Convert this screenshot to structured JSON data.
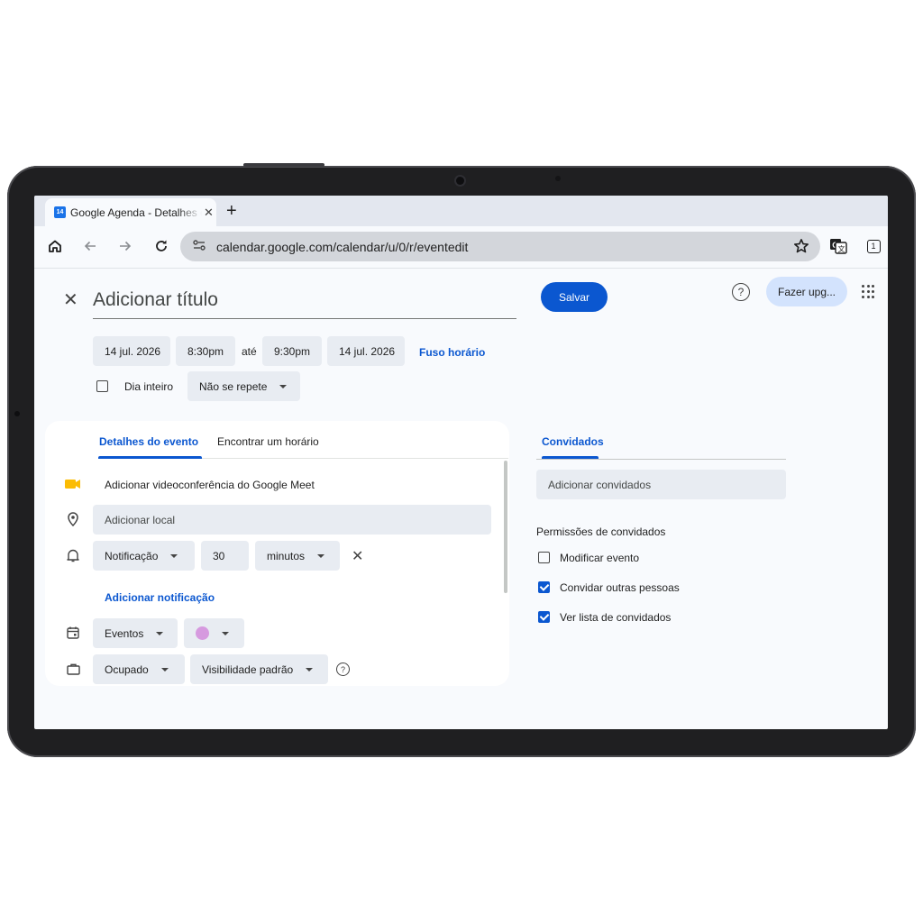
{
  "browser": {
    "tab_title": "Google Agenda - Detalhes do evento",
    "tab_favicon_text": "14",
    "tab_close": "✕",
    "new_tab": "+",
    "url": "calendar.google.com/calendar/u/0/r/eventedit",
    "tab_count": "1",
    "icons": [
      "home-icon",
      "back-icon",
      "forward-icon",
      "reload-icon",
      "site-settings-icon",
      "star-icon",
      "translate-icon",
      "tab-switcher-icon"
    ]
  },
  "header": {
    "close": "✕",
    "title_placeholder": "Adicionar título",
    "save_label": "Salvar",
    "help": "?",
    "upgrade_label": "Fazer upg..."
  },
  "datetime": {
    "start_date": "14 jul. 2026",
    "start_time": "8:30pm",
    "until": "até",
    "end_time": "9:30pm",
    "end_date": "14 jul. 2026",
    "timezone_link": "Fuso horário",
    "all_day_label": "Dia inteiro",
    "all_day_checked": false,
    "repeat": "Não se repete"
  },
  "details": {
    "tabs": [
      "Detalhes do evento",
      "Encontrar um horário"
    ],
    "active_tab": 0,
    "meet_label": "Adicionar videoconferência do Google Meet",
    "location_placeholder": "Adicionar local",
    "notification_type": "Notificação",
    "notification_value": "30",
    "notification_unit": "minutos",
    "remove_notification": "✕",
    "add_notification": "Adicionar notificação",
    "calendar": "Eventos",
    "event_color": "#d69adf",
    "availability": "Ocupado",
    "visibility": "Visibilidade padrão",
    "help": "?"
  },
  "guests": {
    "tab": "Convidados",
    "input_placeholder": "Adicionar convidados",
    "permissions_title": "Permissões de convidados",
    "permissions": [
      {
        "label": "Modificar evento",
        "checked": false
      },
      {
        "label": "Convidar outras pessoas",
        "checked": true
      },
      {
        "label": "Ver lista de convidados",
        "checked": true
      }
    ]
  },
  "colors": {
    "accent": "#0b57d0",
    "chip_bg": "#e8ecf2",
    "upgrade_bg": "#d3e3fd",
    "meet_icon": "#fbbc04"
  }
}
